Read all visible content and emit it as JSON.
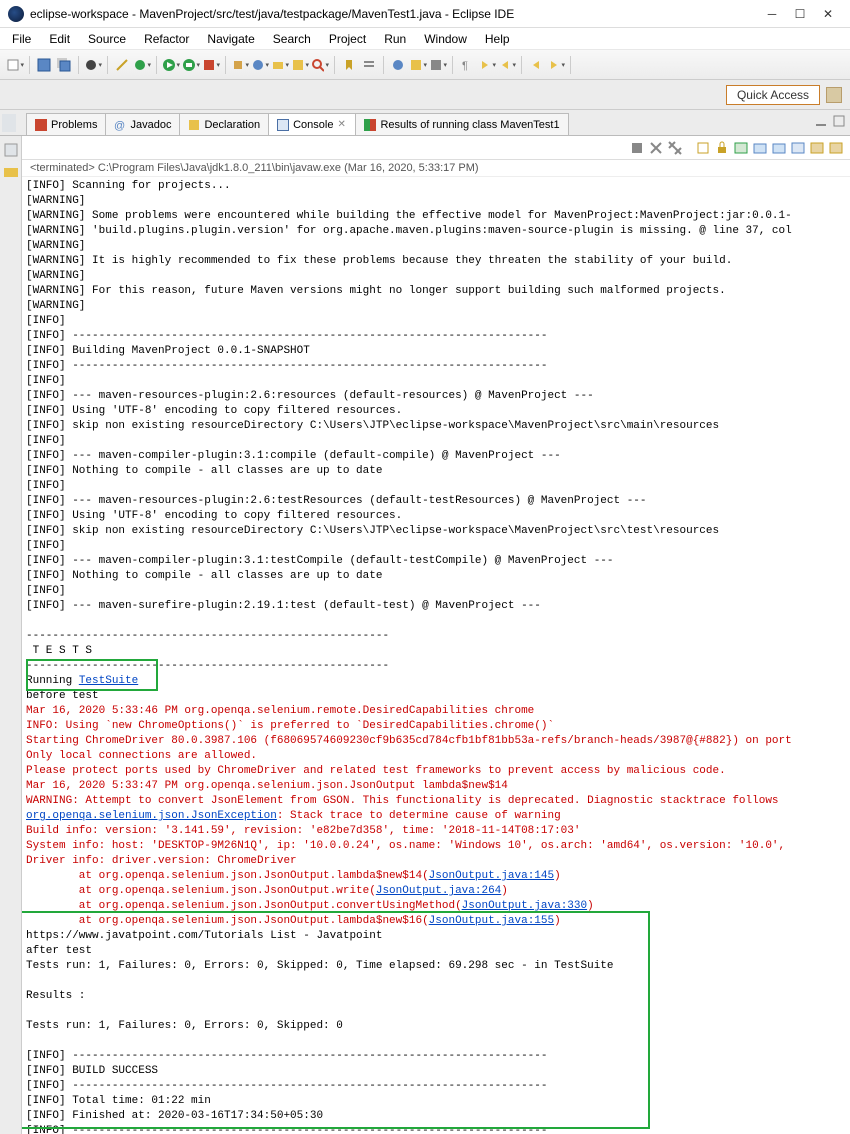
{
  "window": {
    "title": "eclipse-workspace - MavenProject/src/test/java/testpackage/MavenTest1.java - Eclipse IDE"
  },
  "menu": {
    "items": [
      "File",
      "Edit",
      "Source",
      "Refactor",
      "Navigate",
      "Search",
      "Project",
      "Run",
      "Window",
      "Help"
    ]
  },
  "quickAccess": "Quick Access",
  "tabs": [
    {
      "label": "Problems",
      "icon": "problems-icon"
    },
    {
      "label": "Javadoc",
      "icon": "javadoc-icon"
    },
    {
      "label": "Declaration",
      "icon": "declaration-icon"
    },
    {
      "label": "Console",
      "icon": "console-icon",
      "active": true,
      "closable": true
    },
    {
      "label": "Results of running class MavenTest1",
      "icon": "junit-icon"
    }
  ],
  "terminated": "<terminated> C:\\Program Files\\Java\\jdk1.8.0_211\\bin\\javaw.exe (Mar 16, 2020, 5:33:17 PM)",
  "console": {
    "block1": "[INFO] Scanning for projects...\n[WARNING] \n[WARNING] Some problems were encountered while building the effective model for MavenProject:MavenProject:jar:0.0.1-\n[WARNING] 'build.plugins.plugin.version' for org.apache.maven.plugins:maven-source-plugin is missing. @ line 37, col\n[WARNING] \n[WARNING] It is highly recommended to fix these problems because they threaten the stability of your build.\n[WARNING] \n[WARNING] For this reason, future Maven versions might no longer support building such malformed projects.\n[WARNING] \n[INFO]                                                                         \n[INFO] ------------------------------------------------------------------------\n[INFO] Building MavenProject 0.0.1-SNAPSHOT\n[INFO] ------------------------------------------------------------------------\n[INFO] \n[INFO] --- maven-resources-plugin:2.6:resources (default-resources) @ MavenProject ---\n[INFO] Using 'UTF-8' encoding to copy filtered resources.\n[INFO] skip non existing resourceDirectory C:\\Users\\JTP\\eclipse-workspace\\MavenProject\\src\\main\\resources\n[INFO] \n[INFO] --- maven-compiler-plugin:3.1:compile (default-compile) @ MavenProject ---\n[INFO] Nothing to compile - all classes are up to date\n[INFO] \n[INFO] --- maven-resources-plugin:2.6:testResources (default-testResources) @ MavenProject ---\n[INFO] Using 'UTF-8' encoding to copy filtered resources.\n[INFO] skip non existing resourceDirectory C:\\Users\\JTP\\eclipse-workspace\\MavenProject\\src\\test\\resources\n[INFO] \n[INFO] --- maven-compiler-plugin:3.1:testCompile (default-testCompile) @ MavenProject ---\n[INFO] Nothing to compile - all classes are up to date\n[INFO] \n[INFO] --- maven-surefire-plugin:2.19.1:test (default-test) @ MavenProject ---\n\n-------------------------------------------------------\n T E S T S\n-------------------------------------------------------",
    "running": "Running ",
    "testsuite_link": "TestSuite",
    "before": "before test",
    "red1": "Mar 16, 2020 5:33:46 PM org.openqa.selenium.remote.DesiredCapabilities chrome\nINFO: Using `new ChromeOptions()` is preferred to `DesiredCapabilities.chrome()`",
    "black_mixed": "Starting ChromeDriver 80.0.3987.106 (f68069574609230cf9b635cd784cfb1bf81bb53a-refs/branch-heads/3987@{#882}) on port\nOnly local connections are allowed.\nPlease protect ports used by ChromeDriver and related test frameworks to prevent access by malicious code.",
    "red2": "Mar 16, 2020 5:33:47 PM org.openqa.selenium.json.JsonOutput lambda$new$14\nWARNING: Attempt to convert JsonElement from GSON. This functionality is deprecated. Diagnostic stacktrace follows",
    "exc_link": "org.openqa.selenium.json.JsonException",
    "exc_after": ": Stack trace to determine cause of warning",
    "red3": "Build info: version: '3.141.59', revision: 'e82be7d358', time: '2018-11-14T08:17:03'\nSystem info: host: 'DESKTOP-9M26N1Q', ip: '10.0.0.24', os.name: 'Windows 10', os.arch: 'amd64', os.version: '10.0',\nDriver info: driver.version: ChromeDriver",
    "at1": "        at org.openqa.selenium.json.JsonOutput.lambda$new$14(",
    "at1_link": "JsonOutput.java:145",
    "at2": "        at org.openqa.selenium.json.JsonOutput.write(",
    "at2_link": "JsonOutput.java:264",
    "at3": "        at org.openqa.selenium.json.JsonOutput.convertUsingMethod(",
    "at3_link": "JsonOutput.java:330",
    "at4": "        at org.openqa.selenium.json.JsonOutput.lambda$new$16(",
    "at4_link": "JsonOutput.java:155",
    "results": "https://www.javatpoint.com/Tutorials List - Javatpoint\nafter test\nTests run: 1, Failures: 0, Errors: 0, Skipped: 0, Time elapsed: 69.298 sec - in TestSuite\n\nResults :\n\nTests run: 1, Failures: 0, Errors: 0, Skipped: 0\n\n[INFO] ------------------------------------------------------------------------\n[INFO] BUILD SUCCESS\n[INFO] ------------------------------------------------------------------------\n[INFO] Total time: 01:22 min\n[INFO] Finished at: 2020-03-16T17:34:50+05:30\n[INFO] ------------------------------------------------------------------------"
  }
}
